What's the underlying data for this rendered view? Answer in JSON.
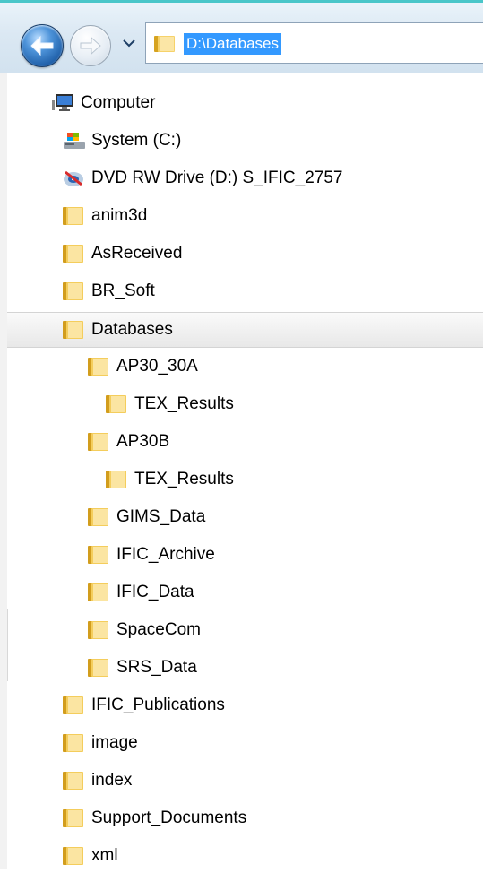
{
  "address": {
    "path": "D:\\Databases"
  },
  "tree": [
    {
      "label": "Computer",
      "icon": "computer-icon",
      "level": 0
    },
    {
      "label": "System (C:)",
      "icon": "system-drive-icon",
      "level": 1
    },
    {
      "label": "DVD RW Drive (D:) S_IFIC_2757",
      "icon": "dvd-drive-icon",
      "level": 1
    },
    {
      "label": "anim3d",
      "icon": "folder-icon",
      "level": 2
    },
    {
      "label": "AsReceived",
      "icon": "folder-icon",
      "level": 2
    },
    {
      "label": "BR_Soft",
      "icon": "folder-icon",
      "level": 2
    },
    {
      "label": "Databases",
      "icon": "folder-icon",
      "level": 2,
      "selected": true
    },
    {
      "label": "AP30_30A",
      "icon": "folder-icon",
      "level": 3
    },
    {
      "label": "TEX_Results",
      "icon": "folder-icon",
      "level": 4
    },
    {
      "label": "AP30B",
      "icon": "folder-icon",
      "level": 3
    },
    {
      "label": "TEX_Results",
      "icon": "folder-icon",
      "level": 4
    },
    {
      "label": "GIMS_Data",
      "icon": "folder-icon",
      "level": 3
    },
    {
      "label": "IFIC_Archive",
      "icon": "folder-icon",
      "level": 3
    },
    {
      "label": "IFIC_Data",
      "icon": "folder-icon",
      "level": 3
    },
    {
      "label": "SpaceCom",
      "icon": "folder-icon",
      "level": 3
    },
    {
      "label": "SRS_Data",
      "icon": "folder-icon",
      "level": 3
    },
    {
      "label": "IFIC_Publications",
      "icon": "folder-icon",
      "level": 2
    },
    {
      "label": "image",
      "icon": "folder-icon",
      "level": 2
    },
    {
      "label": "index",
      "icon": "folder-icon",
      "level": 2
    },
    {
      "label": "Support_Documents",
      "icon": "folder-icon",
      "level": 2
    },
    {
      "label": "xml",
      "icon": "folder-icon",
      "level": 2
    }
  ]
}
